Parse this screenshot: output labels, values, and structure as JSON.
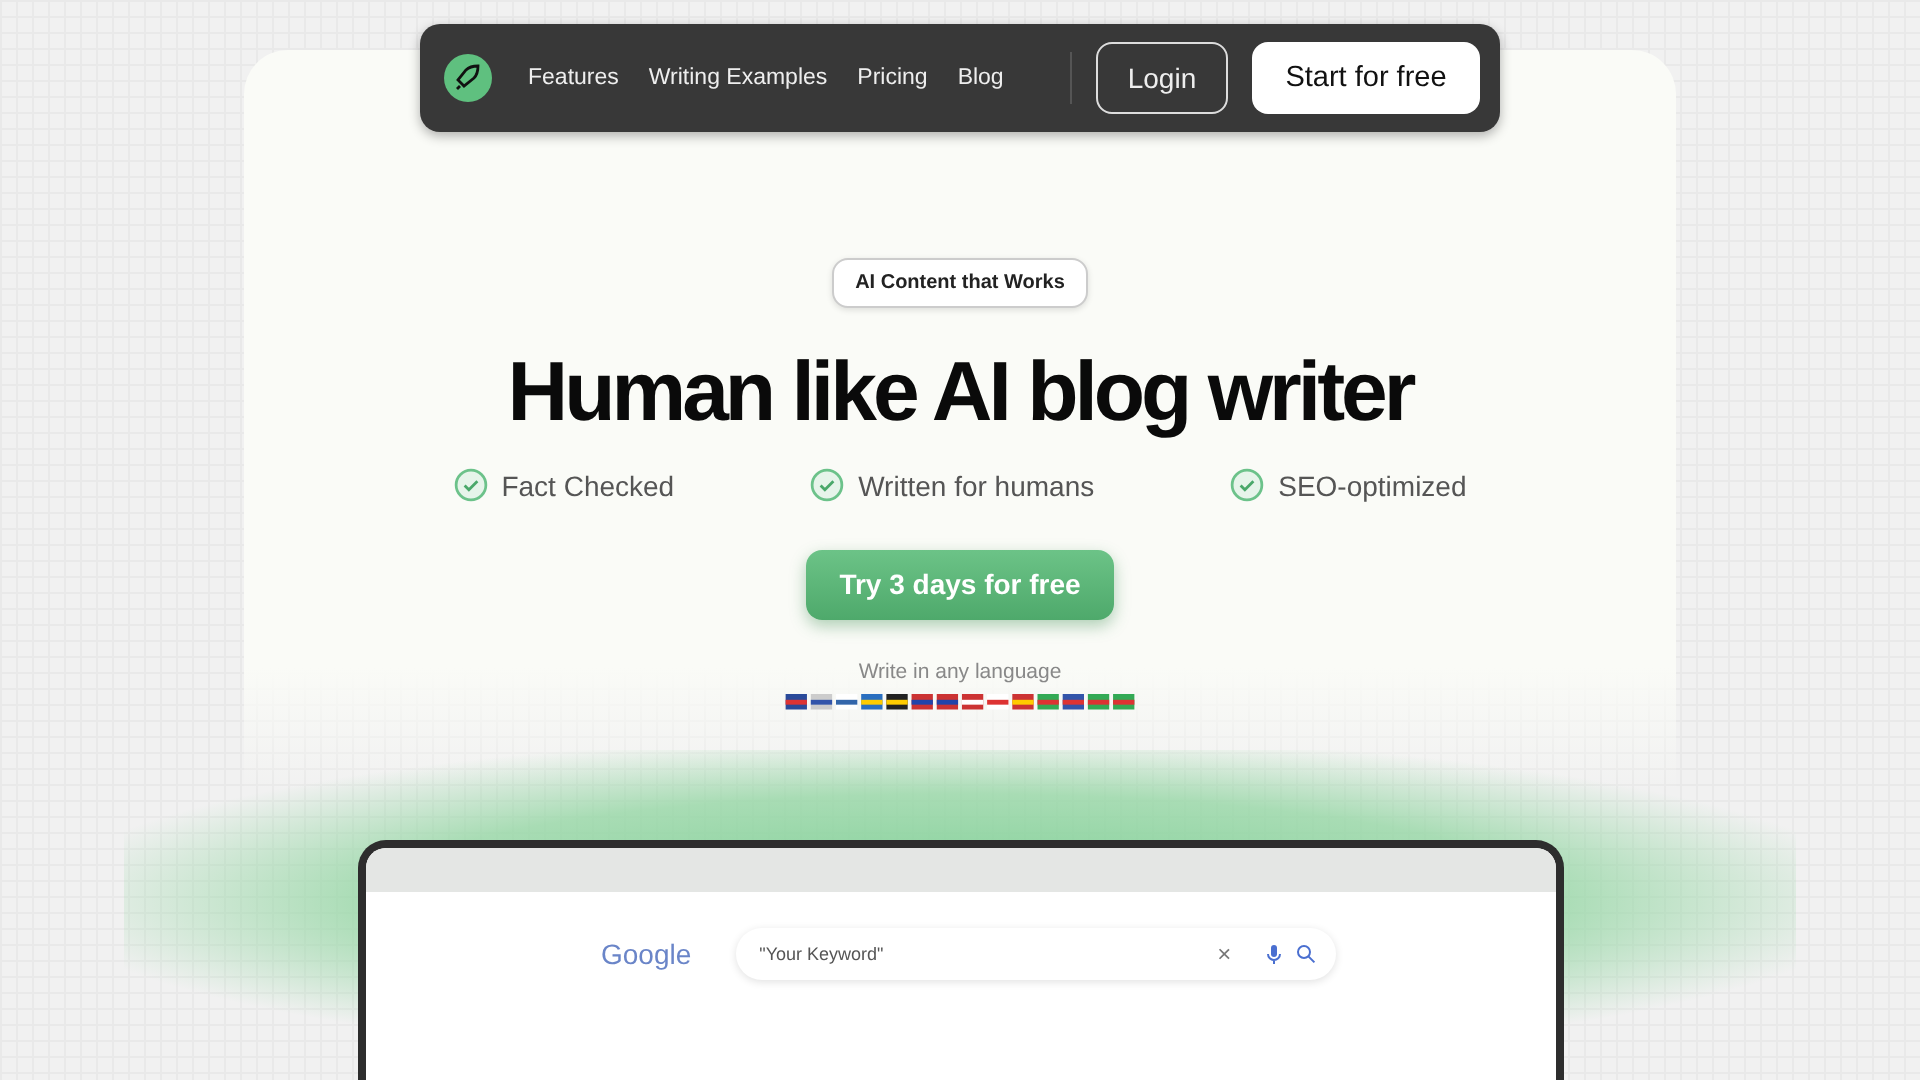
{
  "nav": {
    "links": [
      "Features",
      "Writing Examples",
      "Pricing",
      "Blog"
    ],
    "login": "Login",
    "cta": "Start for free"
  },
  "hero": {
    "badge": "AI Content that Works",
    "title": "Human like AI blog writer",
    "features": [
      "Fact Checked",
      "Written for humans",
      "SEO-optimized"
    ],
    "button": "Try 3 days for free",
    "languages_label": "Write in any language"
  },
  "preview": {
    "logo": "Google",
    "search_value": "\"Your Keyword\"",
    "clear": "×"
  }
}
